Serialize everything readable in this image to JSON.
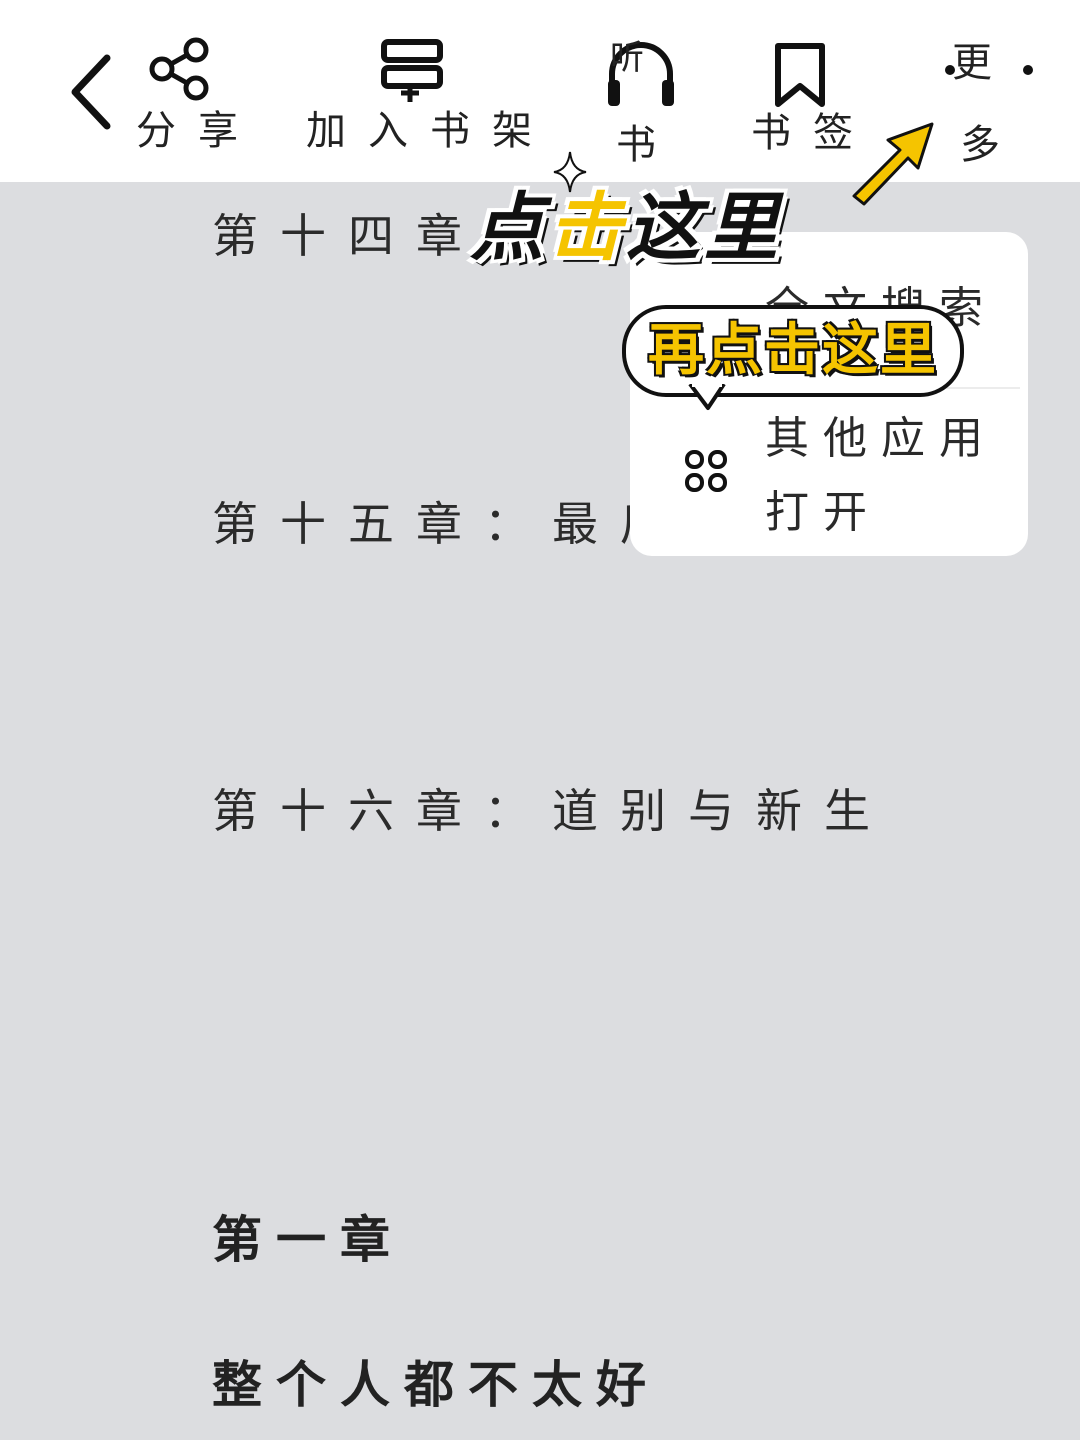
{
  "toolbar": {
    "share_label": "分享",
    "add_shelf_label": "加入书架",
    "listen_label_top": "听",
    "listen_label": "书",
    "bookmark_label": "书签",
    "more_label_top": "更",
    "more_label": "多"
  },
  "content": {
    "chapter_14": "第十四章：",
    "chapter_15": "第十五章：最后",
    "chapter_16": "第十六章：道别与新生",
    "chapter_1_heading": "第一章",
    "paragraph_1": "整个人都不太好"
  },
  "menu": {
    "search_label": "全文搜索",
    "other_app_label": "其他应用打开"
  },
  "annotations": {
    "click_here_part1": "点",
    "click_here_part2": "击",
    "click_here_part3": "这里",
    "click_again": "再点击这里"
  },
  "colors": {
    "page_bg": "#dcdde0",
    "accent_yellow": "#f5c400"
  }
}
